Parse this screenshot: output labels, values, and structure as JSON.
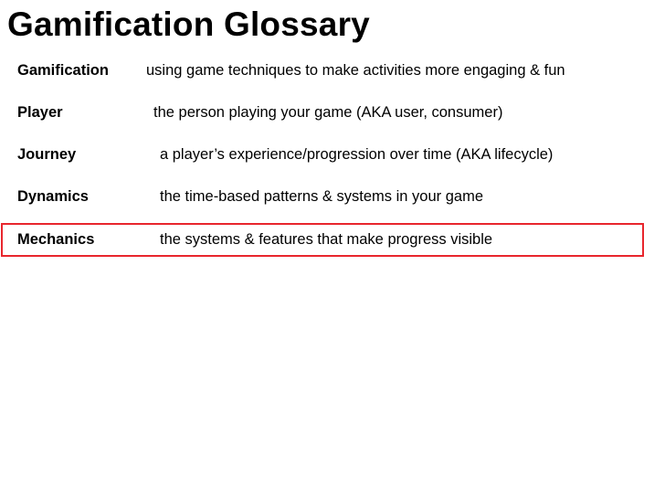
{
  "title": "Gamification Glossary",
  "glossary": [
    {
      "term": "Gamification",
      "definition": "using game techniques to make activities more engaging & fun"
    },
    {
      "term": "Player",
      "definition": "the person playing your game (AKA user, consumer)"
    },
    {
      "term": "Journey",
      "definition": "a player’s experience/progression over time (AKA lifecycle)"
    },
    {
      "term": "Dynamics",
      "definition": "the time-based patterns & systems in your game"
    },
    {
      "term": "Mechanics",
      "definition": "the systems & features that make progress visible"
    }
  ],
  "highlighted_term": "Mechanics",
  "colors": {
    "highlight_border": "#e8262d",
    "text": "#000000",
    "background": "#ffffff"
  }
}
